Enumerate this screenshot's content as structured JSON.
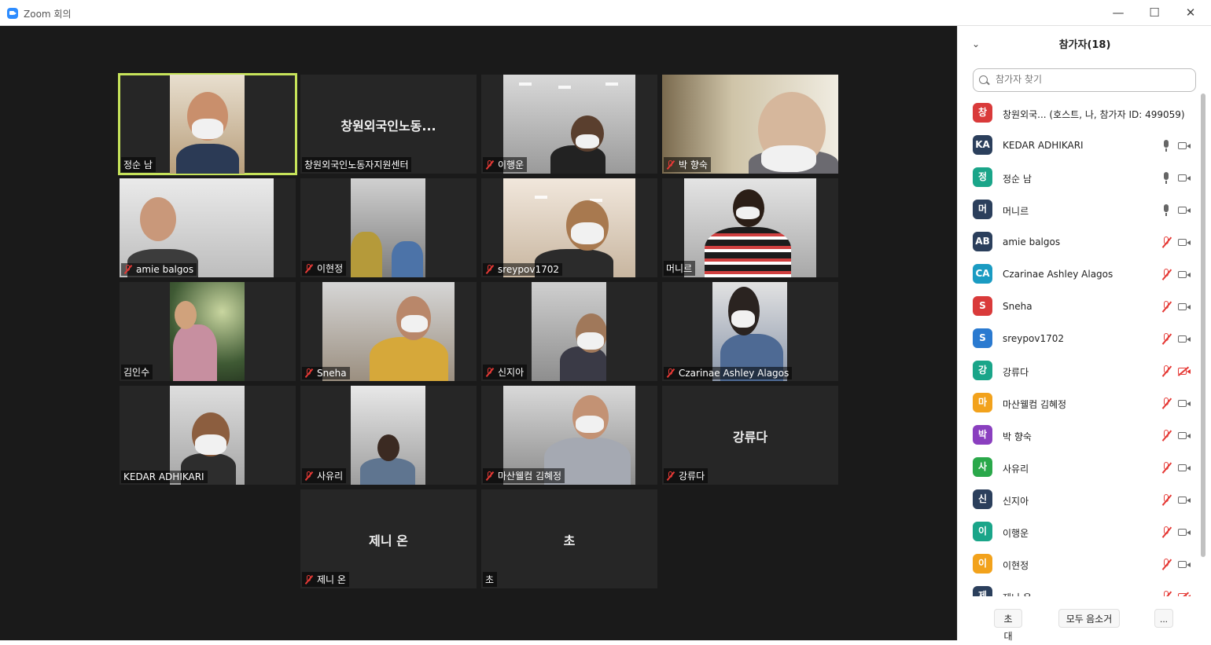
{
  "window": {
    "title": "Zoom 회의",
    "controls": [
      "—",
      "☐",
      "✕"
    ]
  },
  "tiles": [
    {
      "name": "정순 남",
      "muted": false,
      "video": true,
      "active": true
    },
    {
      "name": "창원외국인노동자지원센터",
      "display": "창원외국인노동...",
      "muted": false,
      "video": false
    },
    {
      "name": "이행운",
      "muted": true,
      "video": true
    },
    {
      "name": "박 향숙",
      "muted": true,
      "video": true
    },
    {
      "name": "amie balgos",
      "muted": true,
      "video": true
    },
    {
      "name": "이현정",
      "muted": true,
      "video": true
    },
    {
      "name": "sreypov1702",
      "muted": true,
      "video": true
    },
    {
      "name": "머니르",
      "muted": false,
      "video": true
    },
    {
      "name": "김인수",
      "muted": false,
      "video": true
    },
    {
      "name": "Sneha",
      "muted": true,
      "video": true
    },
    {
      "name": "신지아",
      "muted": true,
      "video": true
    },
    {
      "name": "Czarinae Ashley Alagos",
      "muted": true,
      "video": true
    },
    {
      "name": "KEDAR ADHIKARI",
      "muted": false,
      "video": true
    },
    {
      "name": "사유리",
      "muted": true,
      "video": true
    },
    {
      "name": "마산웰컴 김혜정",
      "muted": true,
      "video": true
    },
    {
      "name": "강류다",
      "display": "강류다",
      "muted": true,
      "video": false
    },
    {
      "name": "제니 온",
      "display": "제니 온",
      "muted": true,
      "video": false
    },
    {
      "name": "초",
      "display": "초",
      "muted": false,
      "video": false
    }
  ],
  "panel": {
    "title": "참가자(18)",
    "search_placeholder": "참가자 찾기",
    "participants": [
      {
        "initial": "창",
        "color": "#d93a3a",
        "name": "창원외국... (호스트, 나, 참가자 ID: 499059)",
        "mic": "none",
        "cam": "none"
      },
      {
        "initial": "KA",
        "color": "#2b3f5c",
        "name": "KEDAR ADHIKARI",
        "mic": "on",
        "cam": "on"
      },
      {
        "initial": "정",
        "color": "#1aa589",
        "name": "정순 남",
        "mic": "on",
        "cam": "on"
      },
      {
        "initial": "머",
        "color": "#2b3f5c",
        "name": "머니르",
        "mic": "on",
        "cam": "on"
      },
      {
        "initial": "AB",
        "color": "#2b3f5c",
        "name": "amie balgos",
        "mic": "muted",
        "cam": "on"
      },
      {
        "initial": "CA",
        "color": "#1a9bc2",
        "name": "Czarinae Ashley Alagos",
        "mic": "muted",
        "cam": "on"
      },
      {
        "initial": "S",
        "color": "#d93a3a",
        "name": "Sneha",
        "mic": "muted",
        "cam": "on"
      },
      {
        "initial": "S",
        "color": "#2a7ad0",
        "name": "sreypov1702",
        "mic": "muted",
        "cam": "on"
      },
      {
        "initial": "강",
        "color": "#1aa589",
        "name": "강류다",
        "mic": "muted",
        "cam": "off"
      },
      {
        "initial": "마",
        "color": "#f2a21c",
        "name": "마산웰컴 김혜정",
        "mic": "muted",
        "cam": "on"
      },
      {
        "initial": "박",
        "color": "#8a3fbf",
        "name": "박 향숙",
        "mic": "muted",
        "cam": "on"
      },
      {
        "initial": "사",
        "color": "#2aa84a",
        "name": "사유리",
        "mic": "muted",
        "cam": "on"
      },
      {
        "initial": "신",
        "color": "#2b3f5c",
        "name": "신지아",
        "mic": "muted",
        "cam": "on"
      },
      {
        "initial": "이",
        "color": "#1aa589",
        "name": "이행운",
        "mic": "muted",
        "cam": "on"
      },
      {
        "initial": "이",
        "color": "#f2a21c",
        "name": "이현정",
        "mic": "muted",
        "cam": "on"
      },
      {
        "initial": "제",
        "color": "#2b3f5c",
        "name": "제니 온",
        "mic": "muted",
        "cam": "off"
      }
    ],
    "buttons": {
      "invite": "초대",
      "mute_all": "모두 음소거",
      "more": "..."
    }
  }
}
